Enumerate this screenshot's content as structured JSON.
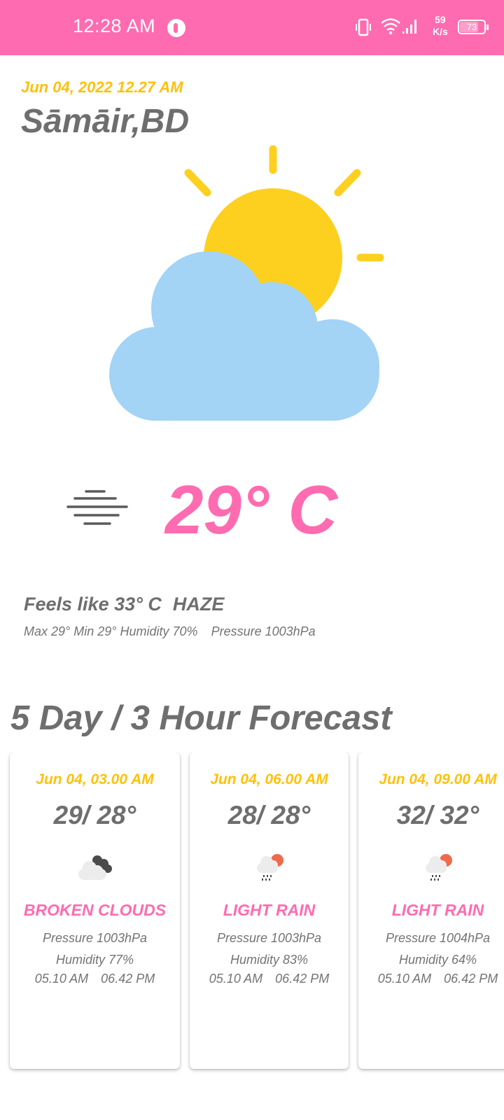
{
  "status_bar": {
    "time": "12:28 AM",
    "speed_value": "59",
    "speed_unit": "K/s",
    "battery": "73",
    "battery_level": 0.73
  },
  "current": {
    "datetime": "Jun 04, 2022 12.27 AM",
    "location": "Sāmāir,BD",
    "temperature": "29° C",
    "feels_like": "Feels like 33° C",
    "condition": "HAZE",
    "max": "Max 29°",
    "min": "Min 29°",
    "humidity": "Humidity 70%",
    "pressure": "Pressure 1003hPa",
    "hero_icon": "partly-cloudy-sun-icon",
    "condition_icon": "haze-icon"
  },
  "forecast": {
    "title": "5 Day / 3 Hour Forecast",
    "cards": [
      {
        "date": "Jun 04, 03.00 AM",
        "temp": "29/ 28°",
        "icon": "broken-clouds-icon",
        "description": "BROKEN CLOUDS",
        "pressure": "Pressure 1003hPa",
        "humidity": "Humidity 77%",
        "sunrise": "05.10 AM",
        "sunset": "06.42 PM"
      },
      {
        "date": "Jun 04, 06.00 AM",
        "temp": "28/ 28°",
        "icon": "light-rain-icon",
        "description": "LIGHT RAIN",
        "pressure": "Pressure 1003hPa",
        "humidity": "Humidity 83%",
        "sunrise": "05.10 AM",
        "sunset": "06.42 PM"
      },
      {
        "date": "Jun 04, 09.00 AM",
        "temp": "32/ 32°",
        "icon": "light-rain-icon",
        "description": "LIGHT RAIN",
        "pressure": "Pressure 1004hPa",
        "humidity": "Humidity 64%",
        "sunrise": "05.10 AM",
        "sunset": "06.42 PM"
      }
    ]
  },
  "colors": {
    "accent_pink": "#ff6bb0",
    "accent_yellow": "#fec10c",
    "text_gray": "#6e6e6e",
    "cloud_blue": "#a3d3f5",
    "sun_yellow": "#fdd020"
  }
}
